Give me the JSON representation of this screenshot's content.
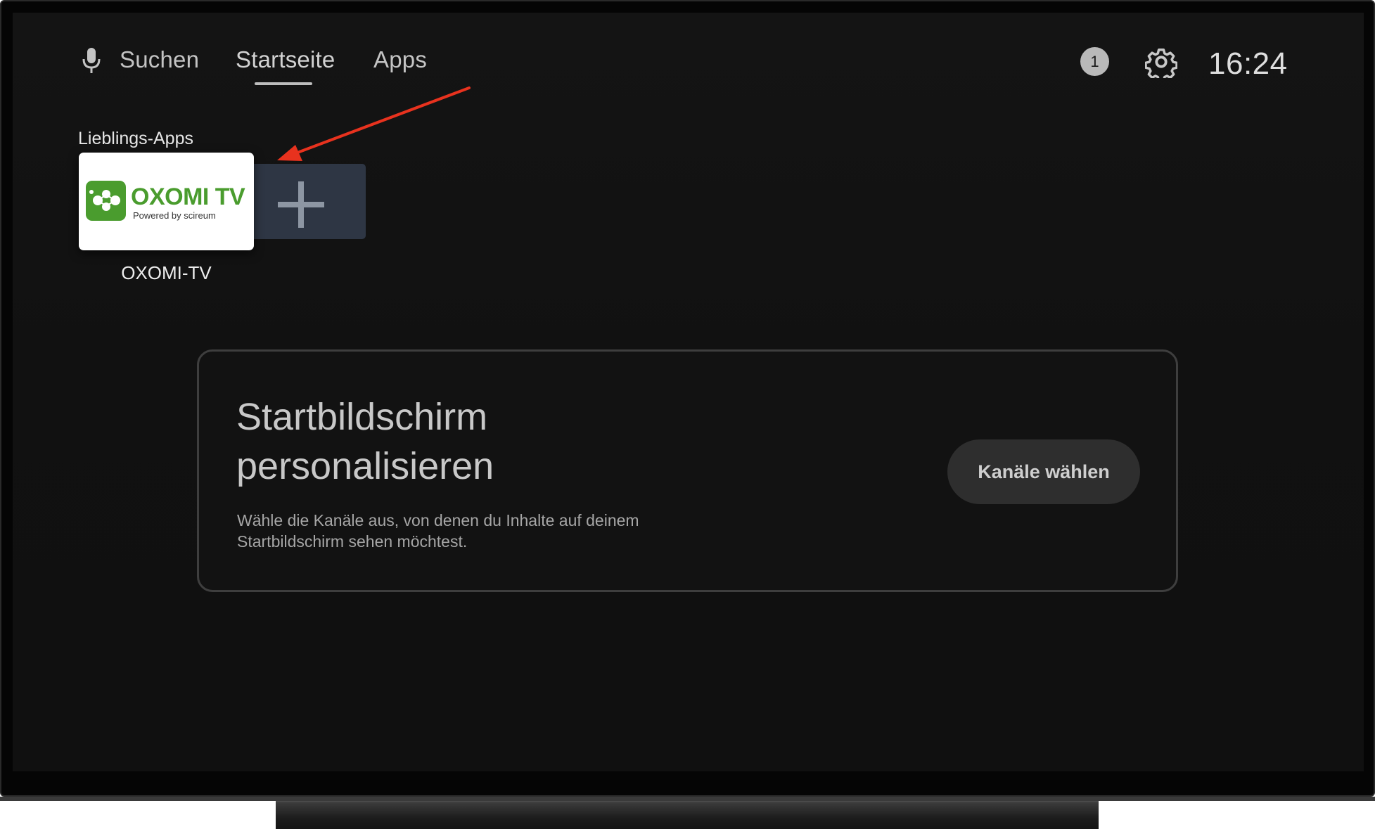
{
  "header": {
    "nav": [
      {
        "label": "Suchen",
        "icon": "microphone-icon"
      },
      {
        "label": "Startseite",
        "selected": true
      },
      {
        "label": "Apps"
      }
    ],
    "notification_count": "1",
    "settings_icon": "gear-icon",
    "time": "16:24"
  },
  "favorites": {
    "heading": "Lieblings-Apps",
    "apps": [
      {
        "label": "OXOMI-TV",
        "logo_text": "OXOMI TV",
        "logo_subtext": "Powered by scireum",
        "brand_color": "#4a9c2e"
      }
    ],
    "add_icon": "plus-icon"
  },
  "personalize": {
    "title_line1": "Startbildschirm",
    "title_line2": "personalisieren",
    "description": "Wähle die Kanäle aus, von denen du Inhalte auf deinem Startbildschirm sehen möchtest.",
    "button_label": "Kanäle wählen"
  },
  "annotation": {
    "arrow_color": "#e8321e"
  }
}
